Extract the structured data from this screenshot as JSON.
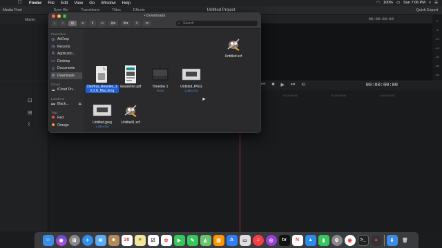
{
  "menubar": {
    "app": "Finder",
    "items": [
      "File",
      "Edit",
      "View",
      "Go",
      "Window",
      "Help"
    ],
    "battery": "100%",
    "clock": "Sun 7:06 PM"
  },
  "resolve": {
    "tabs": [
      "Media Pool",
      "Sync Bin",
      "Transitions",
      "Titles",
      "Effects"
    ],
    "project_title": "Untitled Project",
    "quick_export": "Quick Export",
    "master": "Master",
    "timecode_small": "00:00:00:00",
    "timecode_main": "00:00:00:00",
    "ruler": [
      "01:00:00:00",
      "01:00:04:00",
      "01:00:08:00",
      "01:00:12:00"
    ]
  },
  "finder": {
    "title": "Downloads",
    "search_placeholder": "Search",
    "sidebar": {
      "favourites_header": "Favourites",
      "favourites": [
        {
          "label": "AirDrop",
          "icon": "airdrop-icon"
        },
        {
          "label": "Recents",
          "icon": "clock-icon"
        },
        {
          "label": "Applicatio...",
          "icon": "applications-icon"
        },
        {
          "label": "Desktop",
          "icon": "desktop-icon"
        },
        {
          "label": "Documents",
          "icon": "document-icon"
        },
        {
          "label": "Downloads",
          "icon": "downloads-icon"
        }
      ],
      "icloud_header": "iCloud",
      "icloud": [
        {
          "label": "iCloud Dri...",
          "icon": "cloud-icon"
        }
      ],
      "locations_header": "Locations",
      "locations": [
        {
          "label": "Black...",
          "icon": "disk-icon"
        }
      ],
      "tags_header": "Tags",
      "tags": [
        {
          "label": "Red",
          "color": "#ff4b4b"
        },
        {
          "label": "Orange",
          "color": "#ff9a2e"
        }
      ]
    },
    "files": [
      {
        "name": "Untitled.xcf",
        "sub": "",
        "icon": "gimp-icon"
      },
      {
        "name": "DaVinci_Resolve_1 6.2.8_Mac.dmg",
        "sub": "",
        "icon": "dmg-icon",
        "selected": true
      },
      {
        "name": "newsletter.pdf",
        "sub": "",
        "icon": "pdf-icon"
      },
      {
        "name": "Timeline 1",
        "sub": "00:00",
        "icon": "timeline-icon"
      },
      {
        "name": "Untitled.JPEG",
        "sub": "1,280×720",
        "icon": "jpeg-icon"
      },
      {
        "name": "Untitled.jpeg",
        "sub": "1,280×720",
        "icon": "jpeg-icon"
      },
      {
        "name": "Untitled1.xcf",
        "sub": "",
        "icon": "gimp-icon"
      }
    ]
  },
  "dock": [
    "finder",
    "siri",
    "launchpad",
    "safari",
    "mail",
    "contacts",
    "calendar",
    "notes",
    "reminders",
    "photos",
    "facetime",
    "messages",
    "maps",
    "books",
    "app-store",
    "preview",
    "music",
    "podcasts",
    "tv",
    "news",
    "keynote",
    "numbers",
    "settings",
    "chrome",
    "terminal",
    "resolve",
    "downloads",
    "trash"
  ]
}
